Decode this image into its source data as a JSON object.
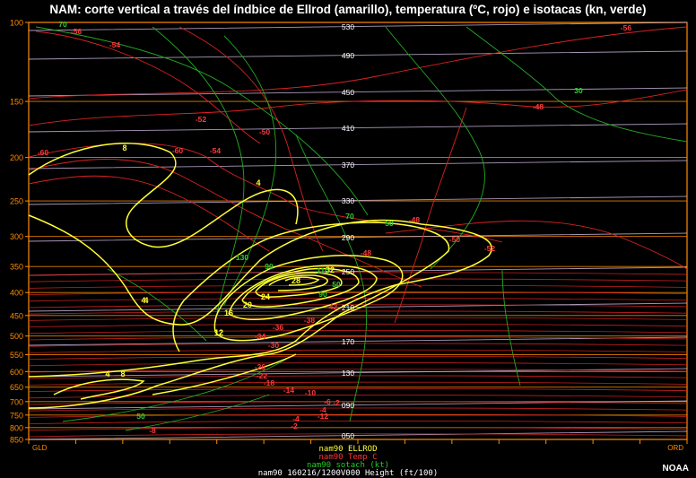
{
  "title": "NAM: corte vertical a través del índbice de Ellrod (amarillo), temperatura (ºC, rojo) e isotacas (kn, verde)",
  "credit": "NOAA",
  "colors": {
    "background": "#000000",
    "ellrod": "#ffff33",
    "temperature": "#dd2222",
    "isotachs": "#22aa22",
    "height": "#c8b4dc",
    "axis": "#ff8c00"
  },
  "legend": {
    "ellrod": "nam90  ELLROD",
    "temp": "nam90  Temp  C",
    "sotach": "nam90  sotach (kt)",
    "footer": "nam90 160216/1200V000 Height (ft/100)"
  },
  "chart_data": {
    "type": "cross-section",
    "x_start_label": "GLD",
    "x_end_label": "ORD",
    "y_axis": {
      "unit": "hPa",
      "scale": "log",
      "range": [
        850,
        100
      ],
      "ticks": [
        "100",
        "150",
        "200",
        "250",
        "300",
        "350",
        "400",
        "450",
        "500",
        "550",
        "600",
        "650",
        "700",
        "750",
        "800",
        "850"
      ]
    },
    "ellrod_labels": [
      "4",
      "4",
      "8",
      "8",
      "4",
      "12",
      "16",
      "20",
      "24",
      "28",
      "32",
      "4",
      "12"
    ],
    "temperature_labels": [
      "-56",
      "-54",
      "-56",
      "-52",
      "-50",
      "-48",
      "-60",
      "-60",
      "-54",
      "-48",
      "-50",
      "-52",
      "-48",
      "-42",
      "-38",
      "-36",
      "-34",
      "-30",
      "-26",
      "-22",
      "-18",
      "-14",
      "-10",
      "-6",
      "-4",
      "-2",
      "-12",
      "-8",
      "-4",
      "-2"
    ],
    "isotach_labels": [
      "70",
      "30",
      "70",
      "50",
      "130",
      "90",
      "110",
      "90",
      "50",
      "50"
    ],
    "height_labels": [
      "530",
      "490",
      "450",
      "410",
      "370",
      "330",
      "290",
      "250",
      "210",
      "170",
      "130",
      "090",
      "050"
    ]
  }
}
